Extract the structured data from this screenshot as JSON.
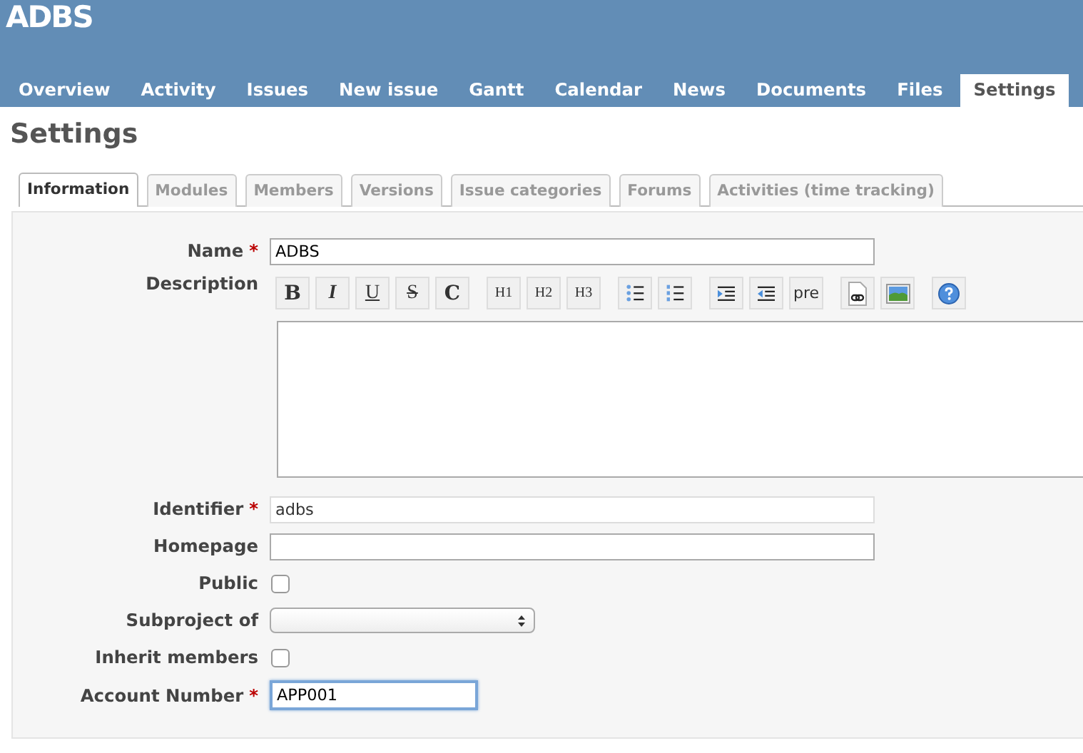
{
  "header": {
    "title": "ADBS"
  },
  "main_tabs": [
    {
      "label": "Overview",
      "selected": false
    },
    {
      "label": "Activity",
      "selected": false
    },
    {
      "label": "Issues",
      "selected": false
    },
    {
      "label": "New issue",
      "selected": false
    },
    {
      "label": "Gantt",
      "selected": false
    },
    {
      "label": "Calendar",
      "selected": false
    },
    {
      "label": "News",
      "selected": false
    },
    {
      "label": "Documents",
      "selected": false
    },
    {
      "label": "Files",
      "selected": false
    },
    {
      "label": "Settings",
      "selected": true
    }
  ],
  "page_title": "Settings",
  "settings_tabs": [
    {
      "label": "Information",
      "selected": true
    },
    {
      "label": "Modules",
      "selected": false
    },
    {
      "label": "Members",
      "selected": false
    },
    {
      "label": "Versions",
      "selected": false
    },
    {
      "label": "Issue categories",
      "selected": false
    },
    {
      "label": "Forums",
      "selected": false
    },
    {
      "label": "Activities (time tracking)",
      "selected": false
    }
  ],
  "form": {
    "name": {
      "label": "Name",
      "required_mark": "*",
      "value": "ADBS"
    },
    "description": {
      "label": "Description",
      "toolbar_groups": [
        [
          {
            "kind": "bold",
            "label": "B"
          },
          {
            "kind": "italic",
            "label": "I"
          },
          {
            "kind": "underline",
            "label": "U"
          },
          {
            "kind": "strike",
            "label": "S"
          },
          {
            "kind": "code",
            "label": "C"
          }
        ],
        [
          {
            "kind": "heading",
            "label": "H1"
          },
          {
            "kind": "heading",
            "label": "H2"
          },
          {
            "kind": "heading",
            "label": "H3"
          }
        ],
        [
          {
            "kind": "bullets"
          },
          {
            "kind": "numbers"
          }
        ],
        [
          {
            "kind": "indent"
          },
          {
            "kind": "outdent"
          },
          {
            "kind": "pre",
            "label": "pre"
          }
        ],
        [
          {
            "kind": "link"
          },
          {
            "kind": "image"
          }
        ],
        [
          {
            "kind": "help"
          }
        ]
      ]
    },
    "fields": [
      {
        "kind": "text",
        "label": "Identifier",
        "required_mark": "*",
        "value": "adbs",
        "disabled": true,
        "focused": false
      },
      {
        "kind": "text",
        "label": "Homepage",
        "focused": false,
        "disabled": false
      },
      {
        "kind": "checkbox",
        "label": "Public",
        "checked": false
      },
      {
        "kind": "select",
        "label": "Subproject of"
      },
      {
        "kind": "checkbox",
        "label": "Inherit members",
        "checked": false
      },
      {
        "kind": "short-text",
        "label": "Account Number",
        "required_mark": "*",
        "value": "APP001",
        "focused": true,
        "disabled": false
      }
    ]
  }
}
